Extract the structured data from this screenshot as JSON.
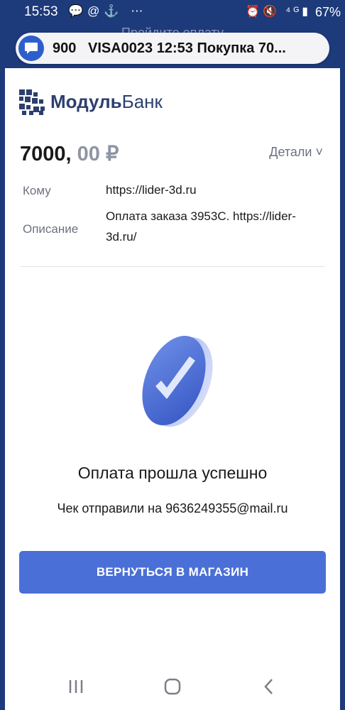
{
  "status_bar": {
    "time": "15:53",
    "left_icons": "💬@⚓ ⋯",
    "right_icons": "⏰🔇 ⁴ᴳ▮",
    "battery": "67%"
  },
  "notification": {
    "sender": "900",
    "message": "VISA0023 12:53 Покупка 70..."
  },
  "background_title": "Пройдите оплату",
  "bank": {
    "name_bold": "Модуль",
    "name_regular": "Банк"
  },
  "payment": {
    "amount_int": "7000,",
    "amount_frac": "00 ₽",
    "details_label": "Детали ˅",
    "to_label": "Кому",
    "to_value": "https://lider-3d.ru",
    "desc_label": "Описание",
    "desc_value": "Оплата заказа 3953С. https://lider-3d.ru/"
  },
  "result": {
    "title": "Оплата прошла успешно",
    "receipt": "Чек отправили на 9636249355@mail.ru"
  },
  "actions": {
    "back_button": "ВЕРНУТЬСЯ В МАГАЗИН"
  },
  "colors": {
    "header_bg": "#1d3a7a",
    "brand": "#2c3f6e",
    "button": "#4a6fd6",
    "notification_icon": "#2d5fcc"
  }
}
